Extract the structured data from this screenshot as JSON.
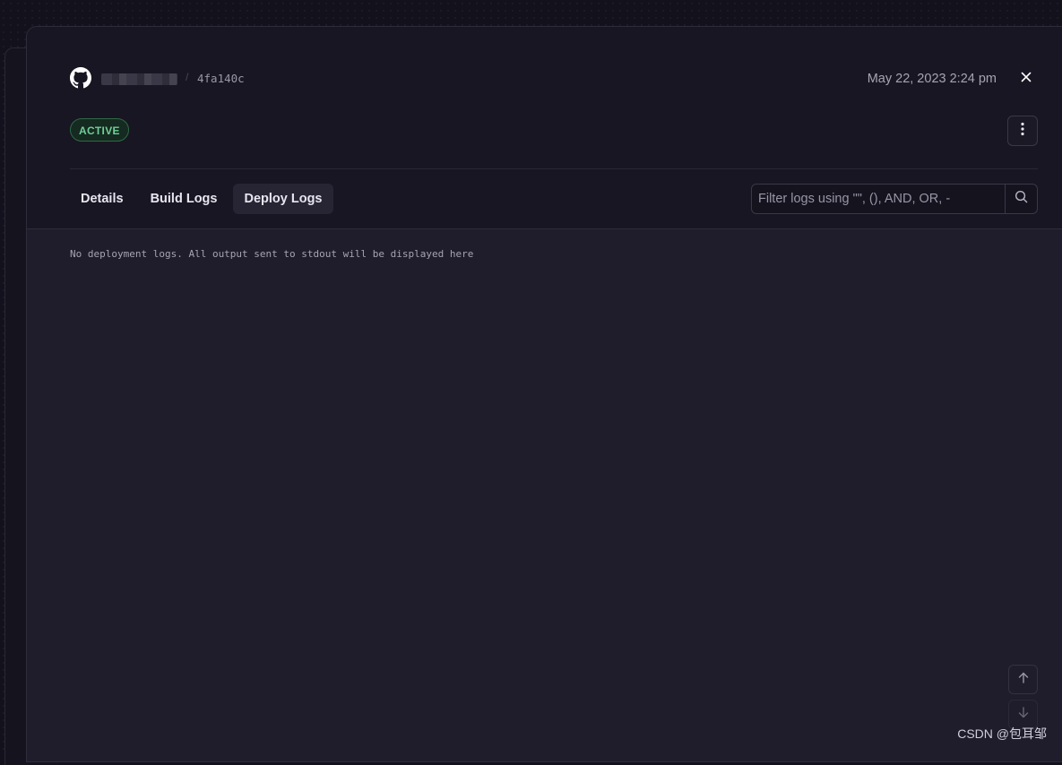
{
  "header": {
    "repo_icon": "github-icon",
    "repo_name": "",
    "separator": "/",
    "commit": "4fa140c",
    "date": "May 22, 2023 2:24 pm",
    "close_icon": "close-icon",
    "status": "ACTIVE",
    "more_icon": "more-vertical-icon"
  },
  "tabs": [
    {
      "label": "Details",
      "active": false
    },
    {
      "label": "Build Logs",
      "active": false
    },
    {
      "label": "Deploy Logs",
      "active": true
    }
  ],
  "search": {
    "placeholder": "Filter logs using \"\", (), AND, OR, -",
    "value": "",
    "icon": "search-icon"
  },
  "logs": {
    "empty_message": "No deployment logs. All output sent to stdout will be displayed here"
  },
  "scroll": {
    "up_icon": "arrow-up-icon",
    "down_icon": "arrow-down-icon"
  },
  "watermark": "CSDN @包耳邹",
  "colors": {
    "background": "#13111c",
    "modal": "#1b1925",
    "log_area": "#1f1d2b",
    "status_green": "#6fcf97"
  }
}
